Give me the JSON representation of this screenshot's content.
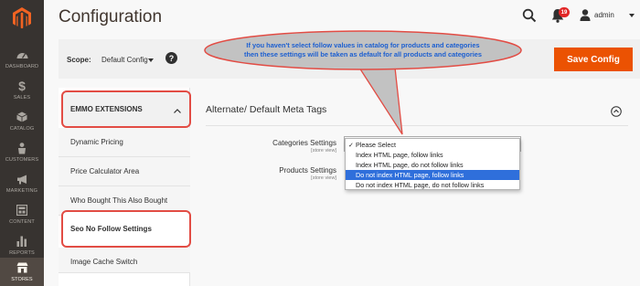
{
  "sidebar": {
    "items": [
      {
        "label": "DASHBOARD",
        "icon": "dashboard-icon"
      },
      {
        "label": "SALES",
        "icon": "dollar-icon"
      },
      {
        "label": "CATALOG",
        "icon": "cube-icon"
      },
      {
        "label": "CUSTOMERS",
        "icon": "person-icon"
      },
      {
        "label": "MARKETING",
        "icon": "megaphone-icon"
      },
      {
        "label": "CONTENT",
        "icon": "layout-icon"
      },
      {
        "label": "REPORTS",
        "icon": "bar-chart-icon"
      },
      {
        "label": "STORES",
        "icon": "store-icon"
      }
    ]
  },
  "header": {
    "title": "Configuration",
    "notification_count": "19",
    "user_name": "admin"
  },
  "scope": {
    "label": "Scope:",
    "value": "Default Config",
    "help_symbol": "?"
  },
  "toolbar": {
    "save_label": "Save Config"
  },
  "tabs": {
    "group_title": "EMMO EXTENSIONS",
    "items": [
      "Dynamic Pricing",
      "Price Calculator Area",
      "Who Bought This Also Bought",
      "Seo No Follow Settings",
      "Image Cache Switch"
    ]
  },
  "section": {
    "title": "Alternate/ Default Meta Tags",
    "fields": [
      {
        "label": "Categories Settings",
        "scope": "[store view]"
      },
      {
        "label": "Products Settings",
        "scope": "[store view]"
      }
    ]
  },
  "dropdown": {
    "check_mark": "✓",
    "options": [
      "Please Select",
      "Index HTML page, follow links",
      "Index HTML page, do not follow links",
      "Do not index HTML page, follow links",
      "Do not index HTML page, do not follow links"
    ]
  },
  "callout": {
    "line1": "If you haven't select follow values in catalog for products and categories",
    "line2": "then these settings will be taken as default for all products and categories"
  },
  "colors": {
    "accent": "#eb5202",
    "annotation_red": "#e24c44",
    "annotation_blue": "#1c5fd1",
    "selection_blue": "#2f6fdb"
  }
}
